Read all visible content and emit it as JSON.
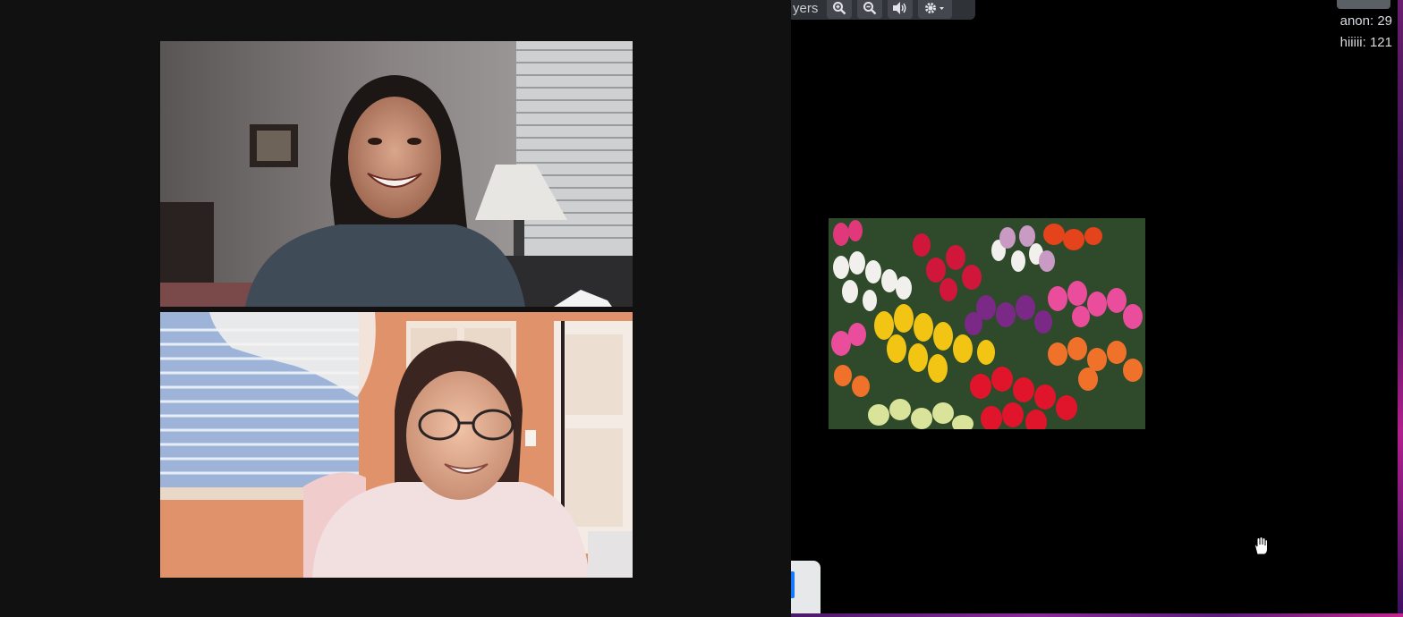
{
  "toolbar": {
    "players_label": "yers",
    "buttons": [
      "zoom-in-icon",
      "zoom-out-icon",
      "volume-icon",
      "settings-icon"
    ]
  },
  "scores": [
    {
      "text": "anon: 29"
    },
    {
      "text": "hiiiii: 121"
    }
  ],
  "colors": {
    "video_panel_bg": "#111111",
    "toolbar_bg": "#2f3237",
    "puzzle_bg": "#000000"
  }
}
